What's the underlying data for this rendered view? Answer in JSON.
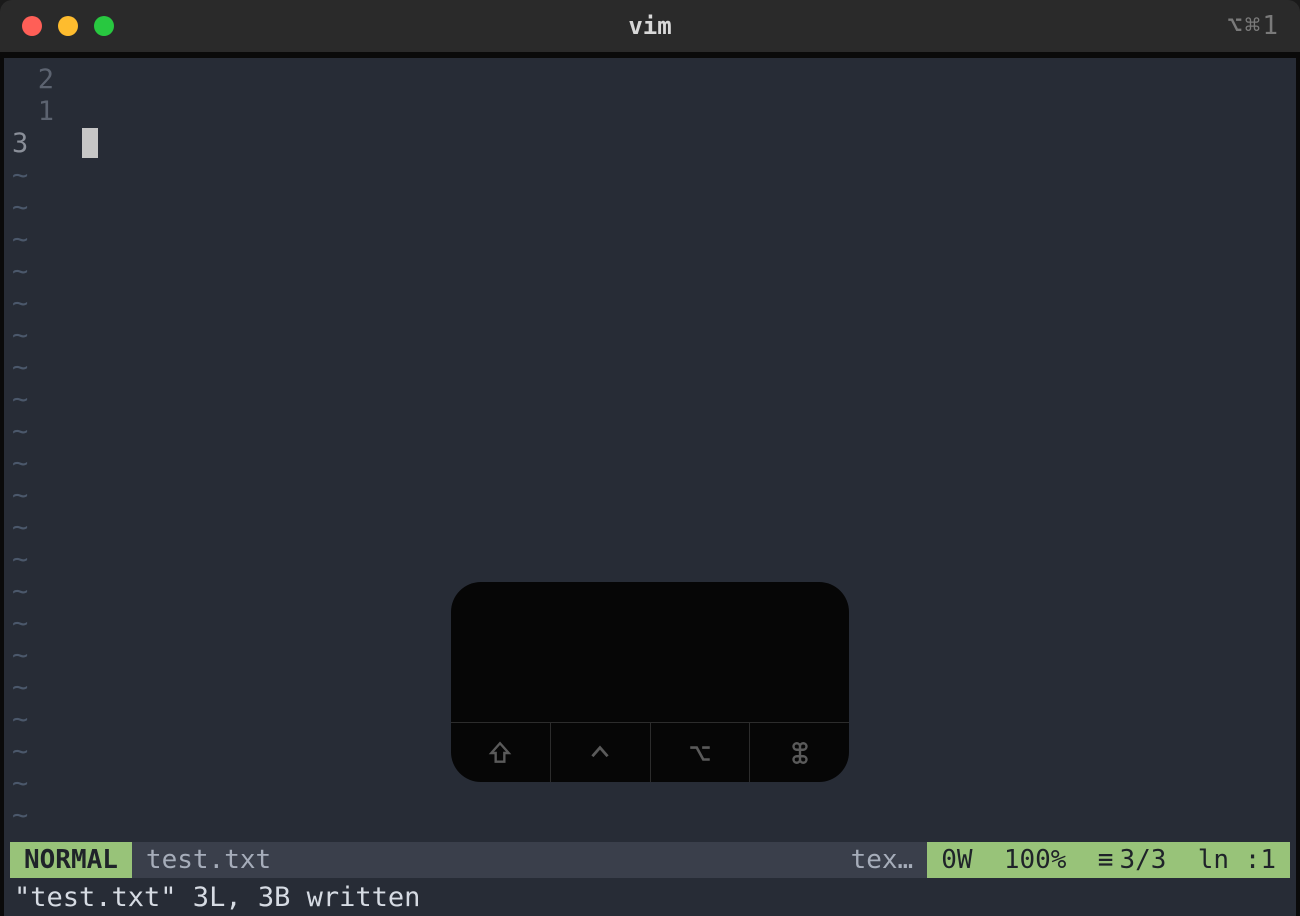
{
  "window": {
    "title": "vim",
    "titlebar_right": "⌥⌘1"
  },
  "editor": {
    "relnum_above": [
      "2",
      "1"
    ],
    "current_line_number": "3",
    "tilde_count": 22
  },
  "statusline": {
    "mode": "NORMAL",
    "filename": "test.txt",
    "filetype_truncated": "tex…",
    "warnings": "0W",
    "percent": "100%",
    "line_indicator_icon": "≡",
    "line_ratio": "3/3",
    "col_label": "ln",
    "col_value": ":1"
  },
  "cmdline": "\"test.txt\" 3L, 3B written",
  "overlay_keys": {
    "shift": "shift",
    "control": "control",
    "option": "option",
    "command": "command"
  }
}
